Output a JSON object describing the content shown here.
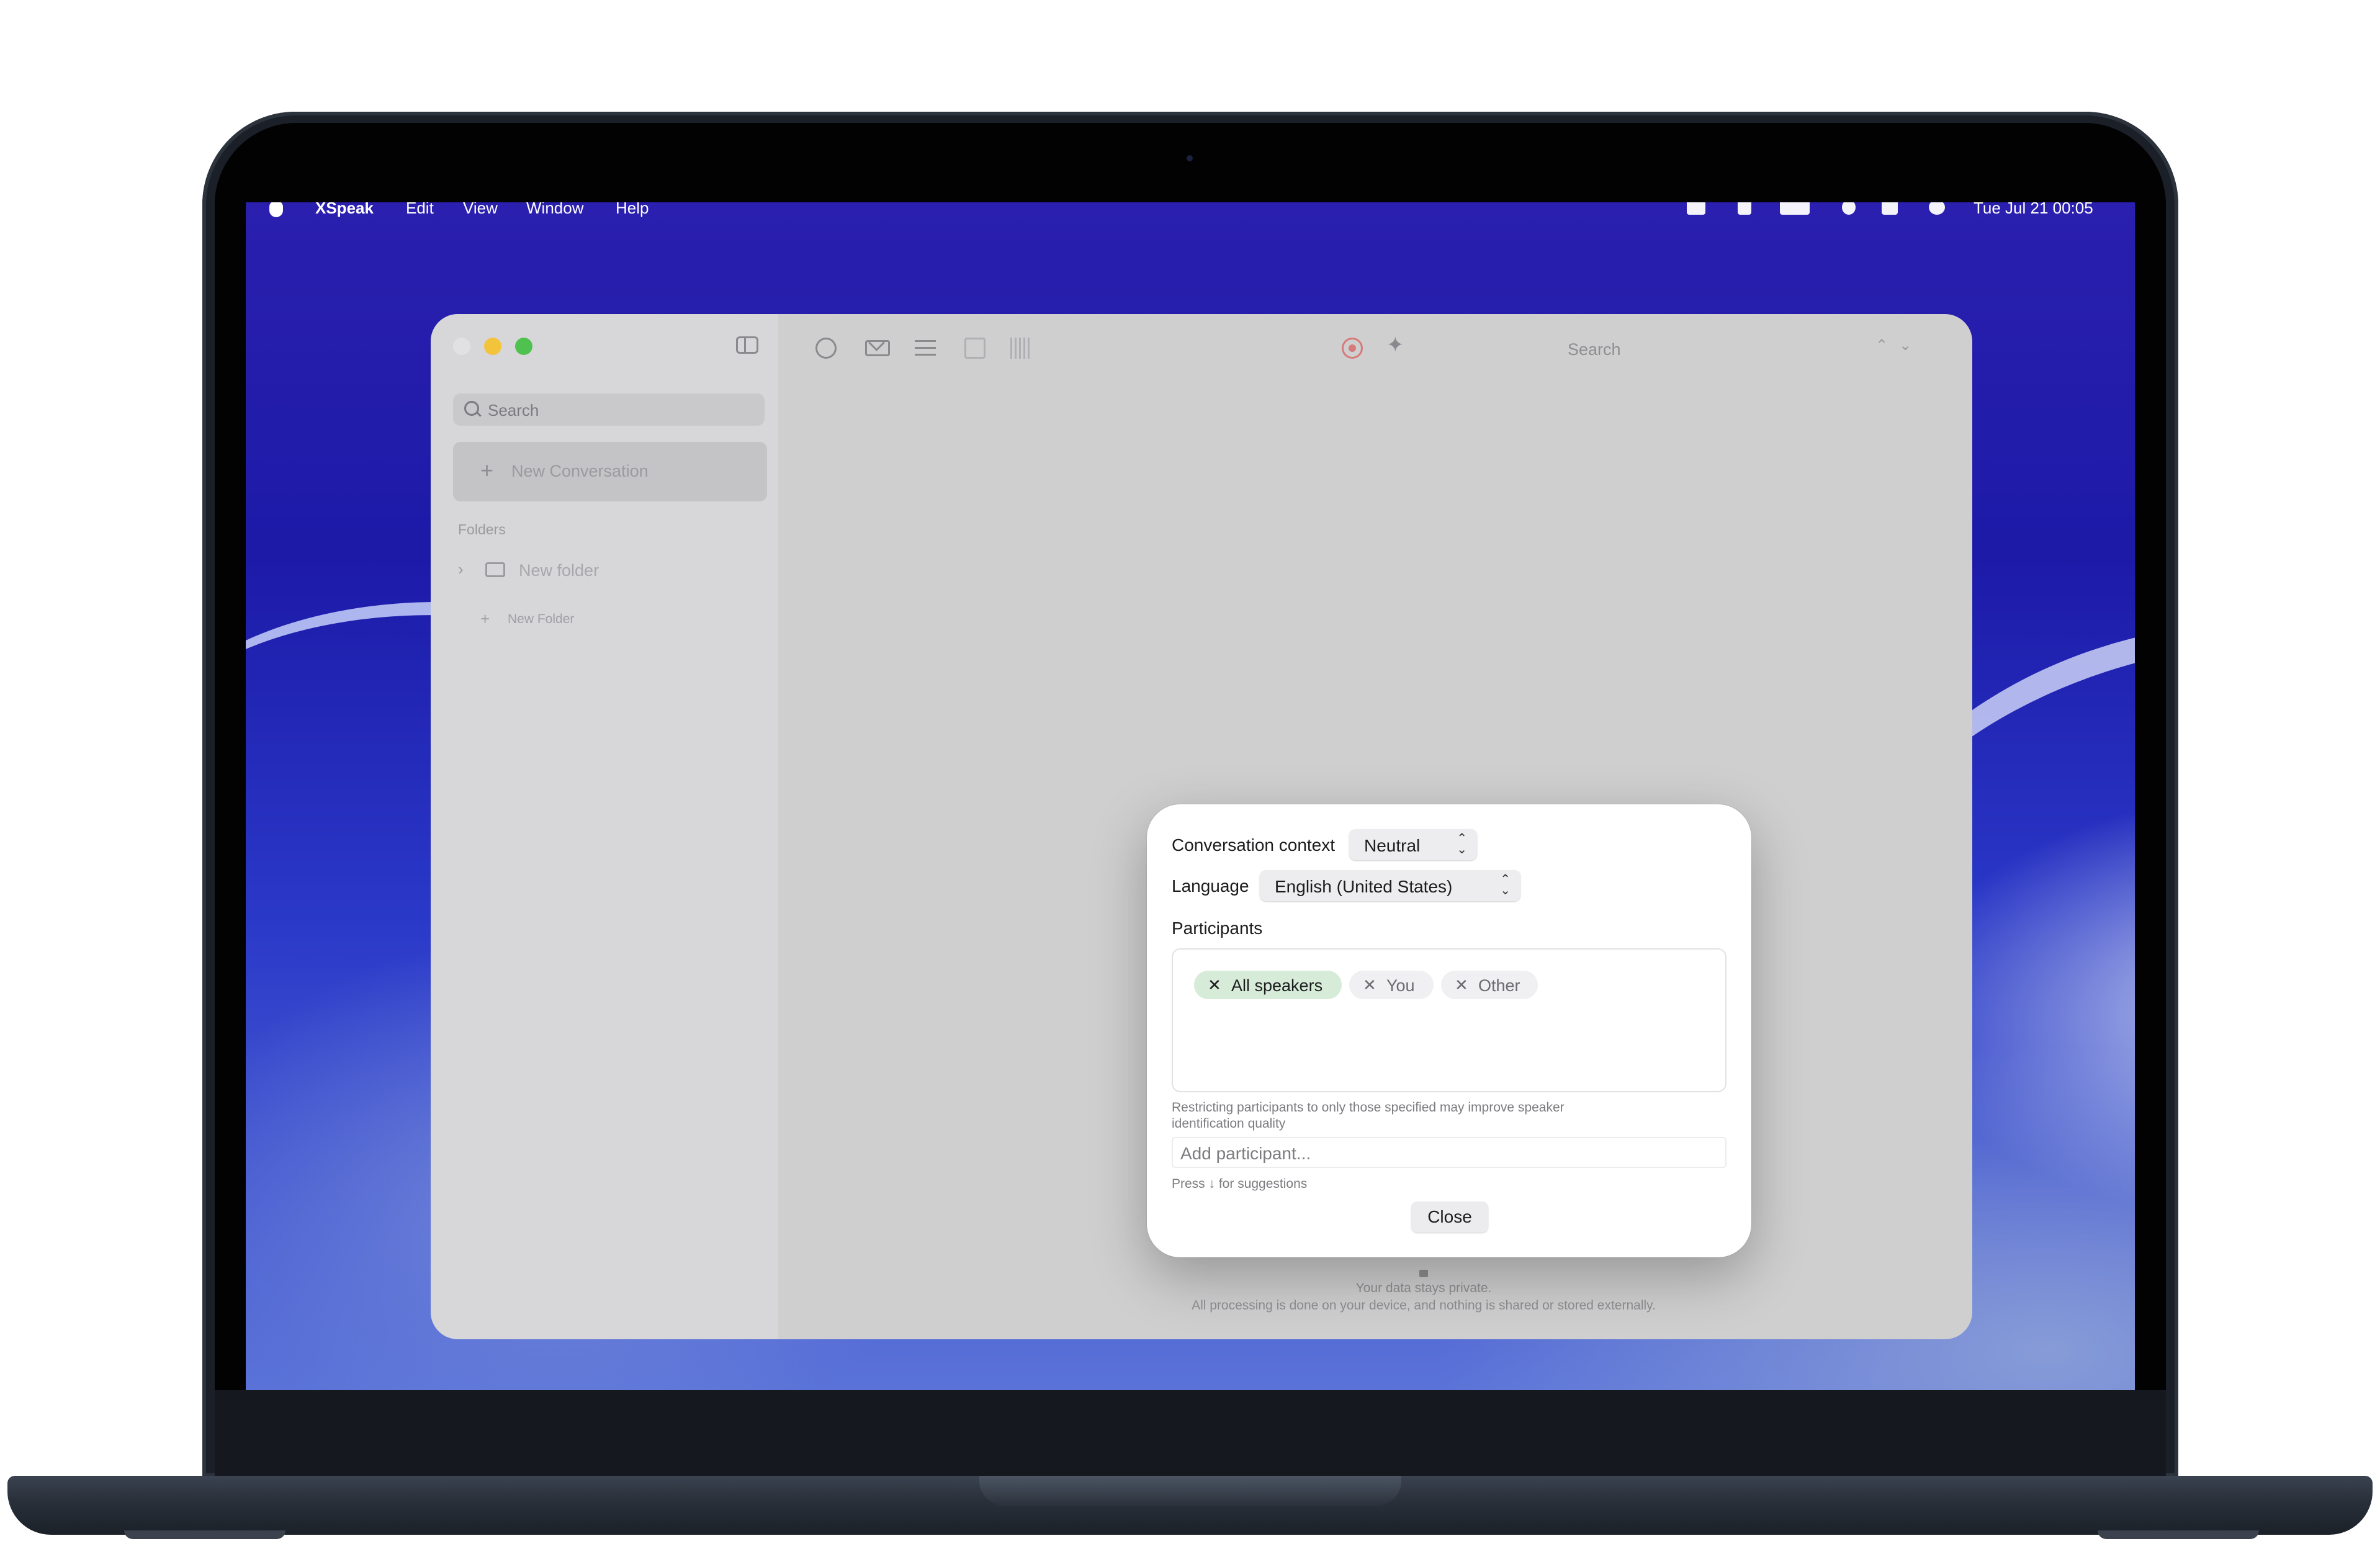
{
  "menubar": {
    "app_name": "XSpeak",
    "items": [
      "Edit",
      "View",
      "Window",
      "Help"
    ],
    "clock": "Tue Jul 21  00:05"
  },
  "sidebar": {
    "search_placeholder": "Search",
    "new_conversation_label": "New Conversation",
    "folders_title": "Folders",
    "folders": [
      {
        "label": "New folder"
      }
    ],
    "new_folder_label": "New Folder"
  },
  "toolbar": {
    "search_placeholder": "Search"
  },
  "privacy": {
    "line1": "Your data stays private.",
    "line2": "All processing is done on your device, and nothing is shared or stored externally."
  },
  "dialog": {
    "context_label": "Conversation context",
    "context_value": "Neutral",
    "language_label": "Language",
    "language_value": "English (United States)",
    "participants_label": "Participants",
    "chips": [
      {
        "label": "All speakers",
        "active": true
      },
      {
        "label": "You",
        "active": false
      },
      {
        "label": "Other",
        "active": false
      }
    ],
    "restriction_hint": "Restricting participants to only those specified may improve speaker identification quality",
    "add_participant_placeholder": "Add participant...",
    "press_hint": "Press ↓ for suggestions",
    "close_label": "Close"
  },
  "colors": {
    "traffic_close": "#e1e1e3",
    "traffic_minimize": "#f3c33c",
    "traffic_zoom": "#4fc14f",
    "active_chip_bg": "#d6ecd8",
    "record_icon": "#d77a7a"
  }
}
